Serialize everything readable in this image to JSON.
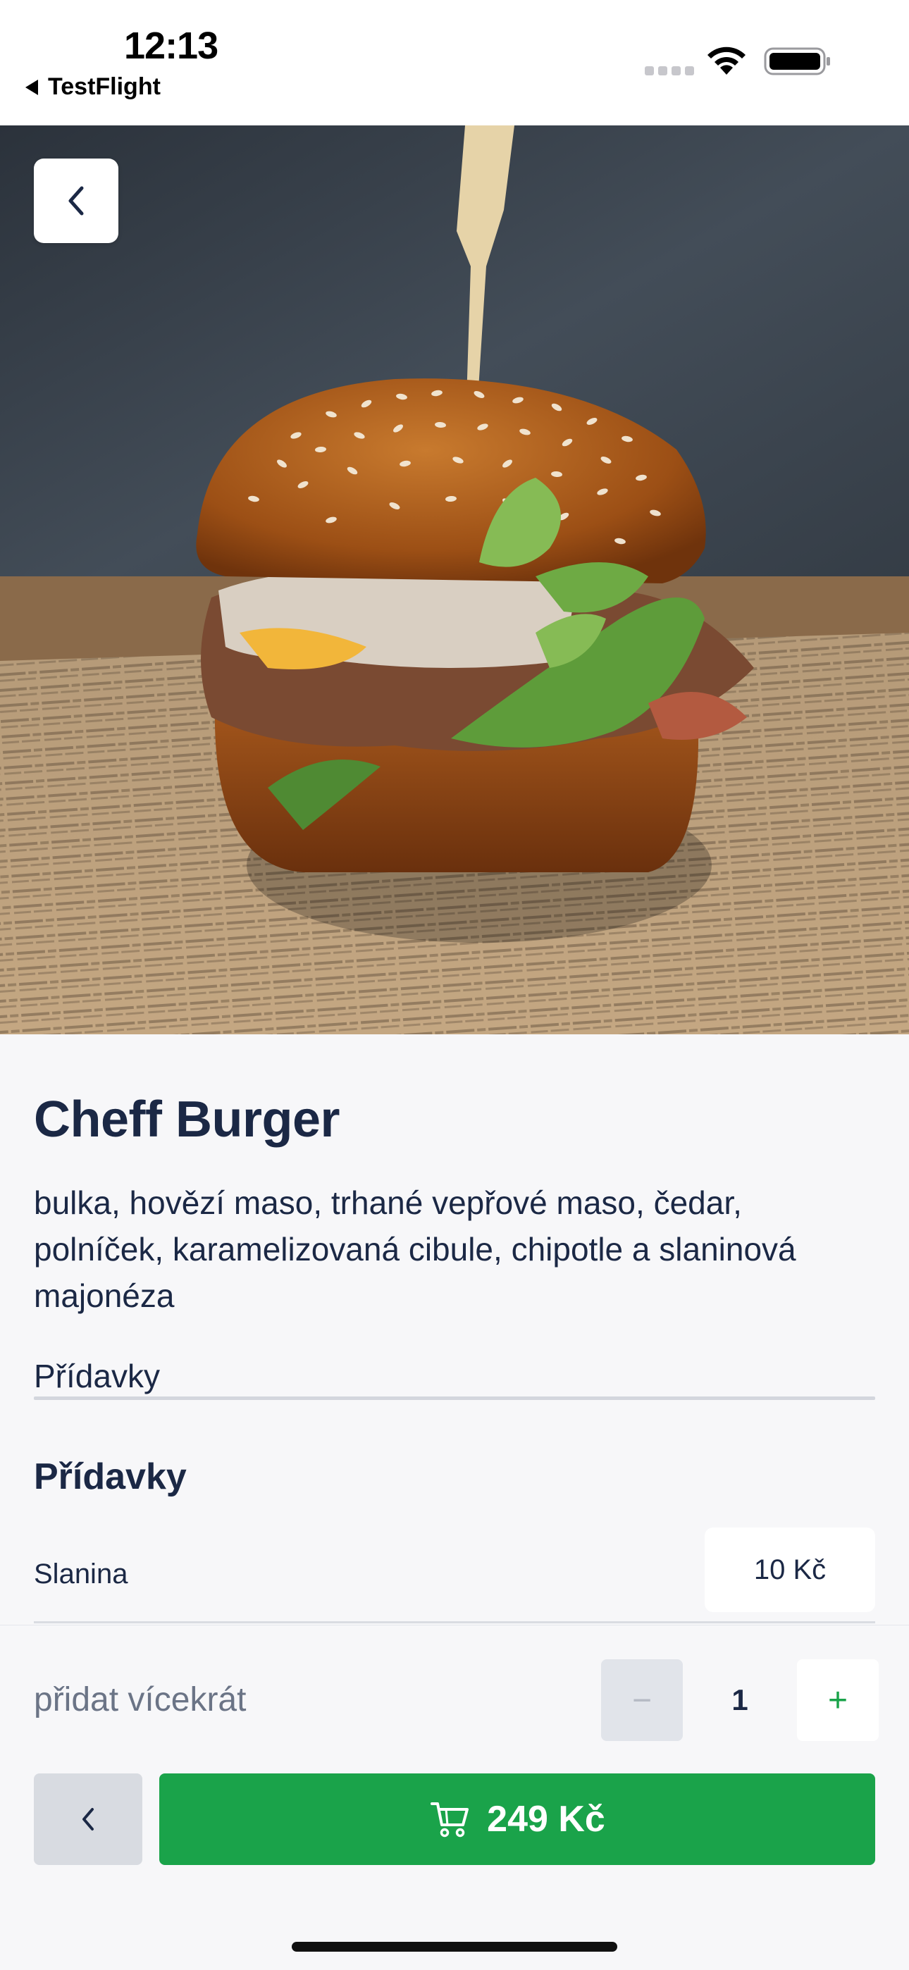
{
  "status_bar": {
    "time": "12:13",
    "back_app": "TestFlight"
  },
  "hero": {
    "image": "burger-photo"
  },
  "product": {
    "title": "Cheff Burger",
    "description": "bulka, hovězí maso, trhané vepřové maso, čedar, polníček, karamelizovaná cibule, chipotle a slaninová majonéza"
  },
  "addons": {
    "tab_label": "Přídavky",
    "heading": "Přídavky",
    "items": [
      {
        "name": "Slanina",
        "price": "10 Kč"
      }
    ]
  },
  "quantity": {
    "label": "přidat vícekrát",
    "value": "1",
    "minus": "−",
    "plus": "+"
  },
  "cart": {
    "total": "249 Kč"
  },
  "colors": {
    "accent_green": "#1aa34a",
    "text_navy": "#1b2845",
    "muted_text": "#6b7486",
    "background": "#f7f7f9"
  }
}
